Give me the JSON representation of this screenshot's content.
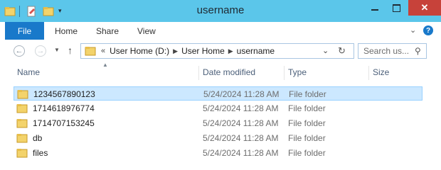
{
  "window": {
    "title": "username"
  },
  "ribbon": {
    "file": "File",
    "tabs": [
      "Home",
      "Share",
      "View"
    ]
  },
  "address": {
    "prefix": "«",
    "crumbs": [
      "User Home (D:)",
      "User Home",
      "username"
    ]
  },
  "search": {
    "placeholder": "Search us..."
  },
  "columns": [
    "Name",
    "Date modified",
    "Type",
    "Size"
  ],
  "files": [
    {
      "name": "1234567890123",
      "date": "5/24/2024 11:28 AM",
      "type": "File folder"
    },
    {
      "name": "1714618976774",
      "date": "5/24/2024 11:28 AM",
      "type": "File folder"
    },
    {
      "name": "1714707153245",
      "date": "5/24/2024 11:28 AM",
      "type": "File folder"
    },
    {
      "name": "db",
      "date": "5/24/2024 11:28 AM",
      "type": "File folder"
    },
    {
      "name": "files",
      "date": "5/24/2024 11:28 AM",
      "type": "File folder"
    }
  ],
  "colors": {
    "titlebar": "#5bc6ea",
    "file_tab": "#1979ca",
    "selection": "#cce8ff",
    "close": "#c7423a"
  }
}
